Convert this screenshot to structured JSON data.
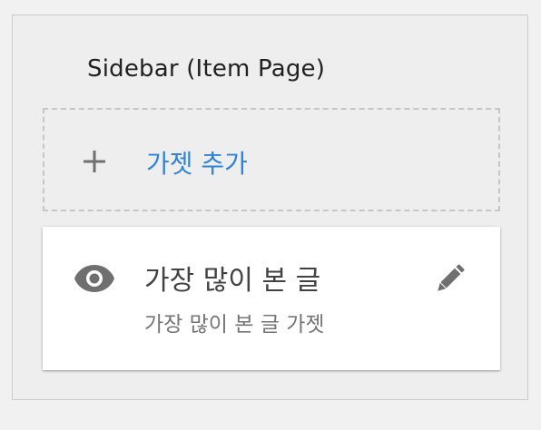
{
  "sidebar": {
    "title": "Sidebar (Item Page)",
    "add_widget": {
      "icon": "plus-icon",
      "label": "가젯 추가"
    },
    "widgets": [
      {
        "icon": "eye-icon",
        "title": "가장 많이 본 글",
        "subtitle": "가장 많이 본 글 가젯",
        "action_icon": "edit-icon"
      }
    ]
  },
  "colors": {
    "background": "#f1f1f1",
    "panel": "#eeeeee",
    "accent": "#2f84d6",
    "icon": "#6f6f6f",
    "title_text": "#212121",
    "card": "#ffffff"
  }
}
